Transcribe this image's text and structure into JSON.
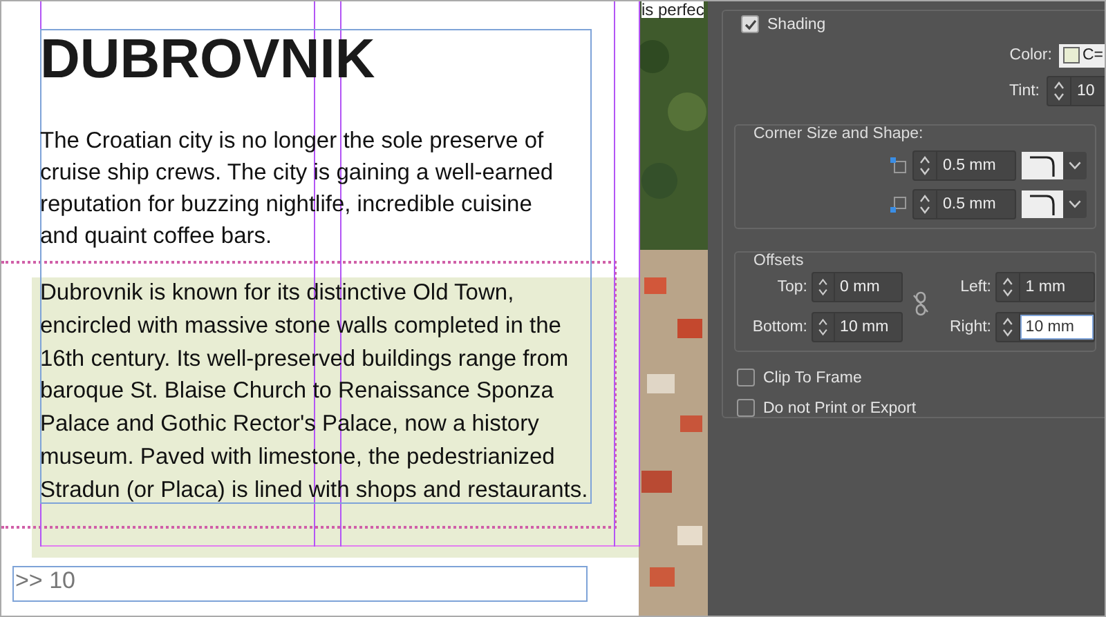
{
  "document": {
    "title": "DUBROVNIK",
    "intro": "The Croatian city is no longer the sole preserve of cruise ship crews. The city is gaining a well-earned reputation for buzzing nightlife, incredible cuisine and quaint coffee bars.",
    "shaded_paragraph": "Dubrovnik is known for its distinctive Old Town, encircled with massive stone walls completed in the 16th century. Its well-preserved buildings range from baroque St. Blaise Church to Renaissance Sponza Palace and Gothic Rector's Palace, now a history museum. Paved with limestone, the pedestrianized Stradun (or Placa) is lined with shops and restaurants.",
    "overflow_field": {
      "value": ">> 10"
    }
  },
  "photo_strip": {
    "caption": "is perfec",
    "kind": "picture"
  },
  "panel": {
    "shading": {
      "label": "Shading",
      "checked": true
    },
    "color": {
      "label": "Color:",
      "value": "C="
    },
    "tint": {
      "label": "Tint:",
      "value": "10"
    },
    "corner": {
      "title": "Corner Size and Shape:",
      "rows": [
        {
          "value": "0.5 mm"
        },
        {
          "value": "0.5 mm"
        }
      ]
    },
    "offsets": {
      "title": "Offsets",
      "fields": [
        {
          "label": "Top:",
          "value": "0 mm",
          "selected": false
        },
        {
          "label": "Left:",
          "value": "1 mm",
          "selected": false
        },
        {
          "label": "Bottom:",
          "value": "10 mm",
          "selected": false
        },
        {
          "label": "Right:",
          "value": "10 mm",
          "selected": true
        }
      ]
    },
    "options": [
      {
        "label": "Clip To Frame",
        "checked": false
      },
      {
        "label": "Do not Print or Export",
        "checked": false
      }
    ]
  }
}
